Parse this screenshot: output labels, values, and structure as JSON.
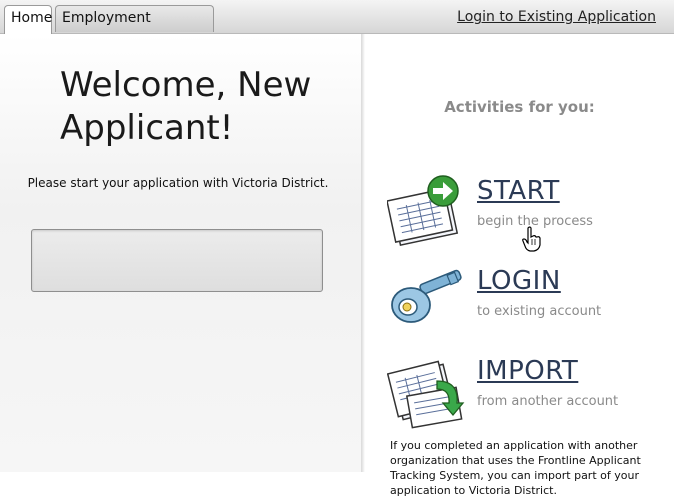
{
  "tabs": [
    {
      "label": "Home"
    },
    {
      "label": "Employment Application"
    }
  ],
  "header": {
    "login_link": "Login to Existing Application"
  },
  "left": {
    "welcome_line1": "Welcome, New",
    "welcome_line2": "Applicant!",
    "instruction": "Please start your application with Victoria District."
  },
  "right": {
    "title": "Activities for you:",
    "activities": [
      {
        "title": "START",
        "subtitle": "begin the process",
        "icon": "document-arrow-icon"
      },
      {
        "title": "LOGIN",
        "subtitle": "to existing account",
        "icon": "key-icon"
      },
      {
        "title": "IMPORT",
        "subtitle": "from another account",
        "icon": "document-import-icon"
      }
    ],
    "footer_text": "If you completed an application with another organization that uses the Frontline Applicant Tracking System, you can import part of your application to Victoria District."
  },
  "colors": {
    "activity_title": "#2b3a55",
    "subtitle": "#8a8a8a",
    "start_arrow": "#3a9d3a"
  }
}
